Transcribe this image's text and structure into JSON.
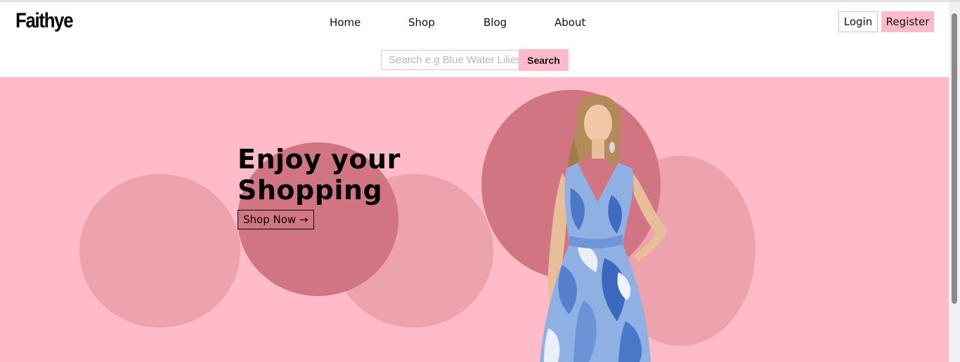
{
  "brand": {
    "name": "Faithye"
  },
  "nav": {
    "items": [
      "Home",
      "Shop",
      "Blog",
      "About"
    ]
  },
  "auth": {
    "login_label": "Login",
    "register_label": "Register"
  },
  "search": {
    "placeholder": "Search e.g Blue Water Lilies",
    "button_label": "Search"
  },
  "hero": {
    "title_line1": "Enjoy your",
    "title_line2": "Shopping",
    "cta_label": "Shop Now →",
    "image": "model-in-blue-tie-dye-dress"
  },
  "colors": {
    "accent": "#ffbbcb",
    "hero_bg": "#ffbbc8",
    "circle_light": "#eca3ad",
    "circle_dark": "#d27583"
  }
}
